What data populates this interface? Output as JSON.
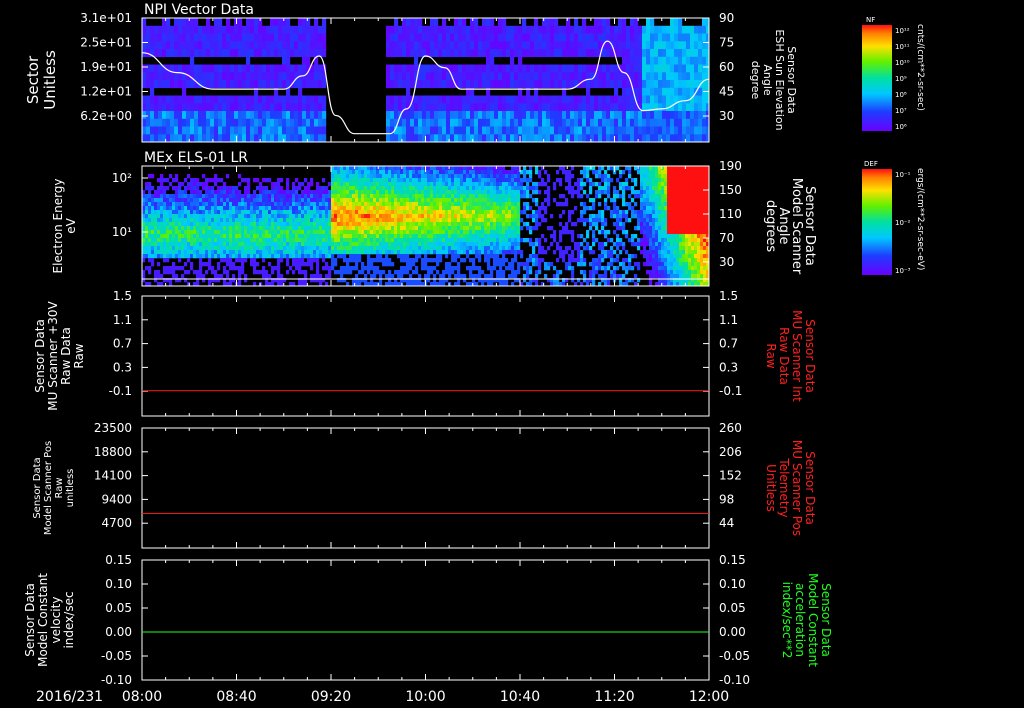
{
  "date_label": "2016/231",
  "time_ticks": [
    "08:00",
    "08:40",
    "09:20",
    "10:00",
    "10:40",
    "11:20",
    "12:00"
  ],
  "colorbars": [
    {
      "tag": "NF",
      "unit": "cnts/(cm**2-sr-sec)",
      "tick_labels": [
        "10¹²",
        "10¹¹",
        "10¹⁰",
        "10⁹",
        "10⁸",
        "10⁷",
        "10⁶"
      ]
    },
    {
      "tag": "DEF",
      "unit": "ergs/(cm**2-sr-sec-eV)",
      "tick_labels": [
        "10⁻¹",
        "10⁻²",
        "10⁻³"
      ]
    }
  ],
  "panels": [
    {
      "title": "NPI Vector Data",
      "left_label": [
        "Sector",
        "Unitless"
      ],
      "right_label": [
        "Sensor Data",
        "ESH Sun Elevation",
        "Angle",
        "degree"
      ],
      "left_ticks": [
        "3.1e+01",
        "2.5e+01",
        "1.9e+01",
        "1.2e+01",
        "6.2e+00"
      ],
      "right_ticks": [
        "90",
        "75",
        "60",
        "45",
        "30"
      ]
    },
    {
      "title": "MEx ELS-01 LR",
      "left_label": [
        "Electron Energy",
        "eV"
      ],
      "right_label": [
        "Sensor Data",
        "Model Scanner",
        "Angle",
        "degrees"
      ],
      "left_ticks": [
        "10²",
        "10¹"
      ],
      "right_ticks": [
        "190",
        "150",
        "110",
        "70",
        "30"
      ]
    },
    {
      "title": "",
      "left_label": [
        "Sensor Data",
        "MU Scanner +30V",
        "Raw Data",
        "Raw"
      ],
      "right_label": [
        "Sensor Data",
        "MU Scanner Int",
        "Raw Data",
        "Raw"
      ],
      "left_ticks": [
        "1.5",
        "1.1",
        "0.7",
        "0.3",
        "-0.1"
      ],
      "right_ticks": [
        "1.5",
        "1.1",
        "0.7",
        "0.3",
        "-0.1"
      ]
    },
    {
      "title": "",
      "left_label": [
        "Sensor Data",
        "Model Scanner Pos",
        "Raw",
        "unitless"
      ],
      "right_label": [
        "Sensor Data",
        "MU Scanner Pos",
        "Telemetry",
        "Unitless"
      ],
      "left_ticks": [
        "23500",
        "18800",
        "14100",
        "9400",
        "4700"
      ],
      "right_ticks": [
        "260",
        "206",
        "152",
        "98",
        "44"
      ]
    },
    {
      "title": "",
      "left_label": [
        "Sensor Data",
        "Model Constant",
        "velocity",
        "index/sec"
      ],
      "right_label": [
        "Sensor Data",
        "Model Constant",
        "acceleration",
        "index/sec**2"
      ],
      "left_ticks": [
        "0.15",
        "0.10",
        "0.05",
        "0.00",
        "-0.05",
        "-0.10"
      ],
      "right_ticks": [
        "0.15",
        "0.10",
        "0.05",
        "0.00",
        "-0.05",
        "-0.10"
      ]
    }
  ],
  "colors": {
    "red_trace": "#ff2020",
    "green_trace": "#20ff20",
    "white_trace": "#ffffff"
  },
  "chart_data": [
    {
      "type": "heatmap",
      "title": "NPI Vector Data",
      "ylabel": "Sector Unitless",
      "y2label": "Sensor Data ESH Sun Elevation Angle degree",
      "x_range": [
        "08:00",
        "12:00"
      ],
      "ylim": [
        0,
        31
      ],
      "y2lim": [
        15,
        90
      ],
      "data_gaps": [
        [
          "09:17",
          "09:43"
        ]
      ],
      "overlay_line": {
        "name": "Sensor Data ESH Sun Elevation Angle",
        "x": [
          "08:00",
          "08:15",
          "08:30",
          "09:00",
          "09:08",
          "09:15",
          "09:22",
          "09:30",
          "09:45",
          "09:52",
          "10:00",
          "10:08",
          "10:15",
          "10:30",
          "11:00",
          "11:10",
          "11:17",
          "11:24",
          "11:32",
          "11:40",
          "11:50",
          "12:00"
        ],
        "y": [
          69,
          57,
          47,
          47,
          55,
          67,
          31,
          20,
          20,
          35,
          67,
          60,
          47,
          47,
          47,
          53,
          76,
          57,
          34,
          35,
          40,
          53
        ]
      }
    },
    {
      "type": "heatmap",
      "title": "MEx ELS-01 LR",
      "ylabel": "Electron Energy eV",
      "y2label": "Sensor Data Model Scanner Angle degrees",
      "x_range": [
        "08:00",
        "12:00"
      ],
      "y_scale": "log",
      "y2lim": [
        0,
        190
      ],
      "overlay_line": {
        "name": "Sensor Data Model Scanner Angle",
        "x": [
          "08:00",
          "12:00"
        ],
        "y": [
          11,
          11
        ]
      }
    },
    {
      "type": "line",
      "ylabel": "Sensor Data MU Scanner +30V Raw Data Raw",
      "y2label": "Sensor Data MU Scanner Int Raw Data Raw",
      "ylim": [
        -0.4,
        1.5
      ],
      "series": [
        {
          "name": "Sensor Data MU Scanner Int Raw Data",
          "x": [
            "08:00",
            "12:00"
          ],
          "y": [
            0,
            0
          ]
        }
      ]
    },
    {
      "type": "line",
      "ylabel": "Sensor Data Model Scanner Pos Raw unitless",
      "y2label": "Sensor Data MU Scanner Pos Telemetry Unitless",
      "ylim": [
        0,
        23500
      ],
      "y2lim": [
        0,
        260
      ],
      "series": [
        {
          "name": "Sensor Data MU Scanner Pos Telemetry",
          "x": [
            "08:00",
            "12:00"
          ],
          "y": [
            75,
            75
          ]
        }
      ]
    },
    {
      "type": "line",
      "ylabel": "Sensor Data Model Constant velocity index/sec",
      "y2label": "Sensor Data Model Constant acceleration index/sec**2",
      "ylim": [
        -0.1,
        0.15
      ],
      "series": [
        {
          "name": "Sensor Data Model Constant acceleration",
          "x": [
            "08:00",
            "12:00"
          ],
          "y": [
            0,
            0
          ]
        }
      ]
    }
  ]
}
